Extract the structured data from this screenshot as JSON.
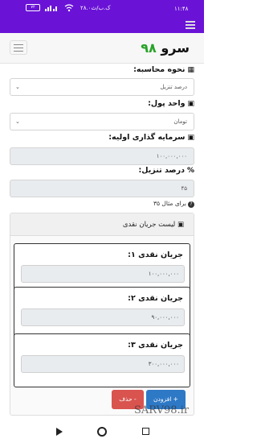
{
  "status_bar": {
    "time": "۱۱:۴۸",
    "net_speed": "۲۸.۰ک.ب/ث",
    "battery": "۷۲"
  },
  "navbar": {
    "brand_word": "سرو",
    "brand_number": "۹۸"
  },
  "form": {
    "calc_method": {
      "label": "نحوه محاسبه:",
      "value": "درصد تنزیل"
    },
    "currency": {
      "label": "واحد پول:",
      "value": "تومان"
    },
    "initial_investment": {
      "label": "سرمایه گذاری اولیه:",
      "value": "۱۰۰,۰۰۰,۰۰۰"
    },
    "discount_rate": {
      "label": "درصد تنزیل:",
      "symbol": "%",
      "value": "۴۵"
    },
    "hint": "برای مثال ۳۵"
  },
  "cash_flow": {
    "title": "لیست جریان نقدی",
    "items": [
      {
        "label": "جریان نقدی ۱:",
        "value": "۱۰۰,۰۰۰,۰۰۰"
      },
      {
        "label": "جریان نقدی ۲:",
        "value": "۹۰,۰۰۰,۰۰۰"
      },
      {
        "label": "جریان نقدی ۳:",
        "value": "۳۰۰,۰۰۰,۰۰۰"
      }
    ],
    "add_label": "+ افزودن",
    "delete_label": "- حذف"
  },
  "watermark": "SARV98.ir",
  "icons": {
    "calculator": "calculator-icon",
    "money": "money-icon",
    "percent": "percent-icon",
    "question": "question-icon"
  },
  "colors": {
    "status_bar": "#6a13d6",
    "brand_number": "#27a327",
    "add_button": "#2e79c6",
    "delete_button": "#d9534f"
  }
}
